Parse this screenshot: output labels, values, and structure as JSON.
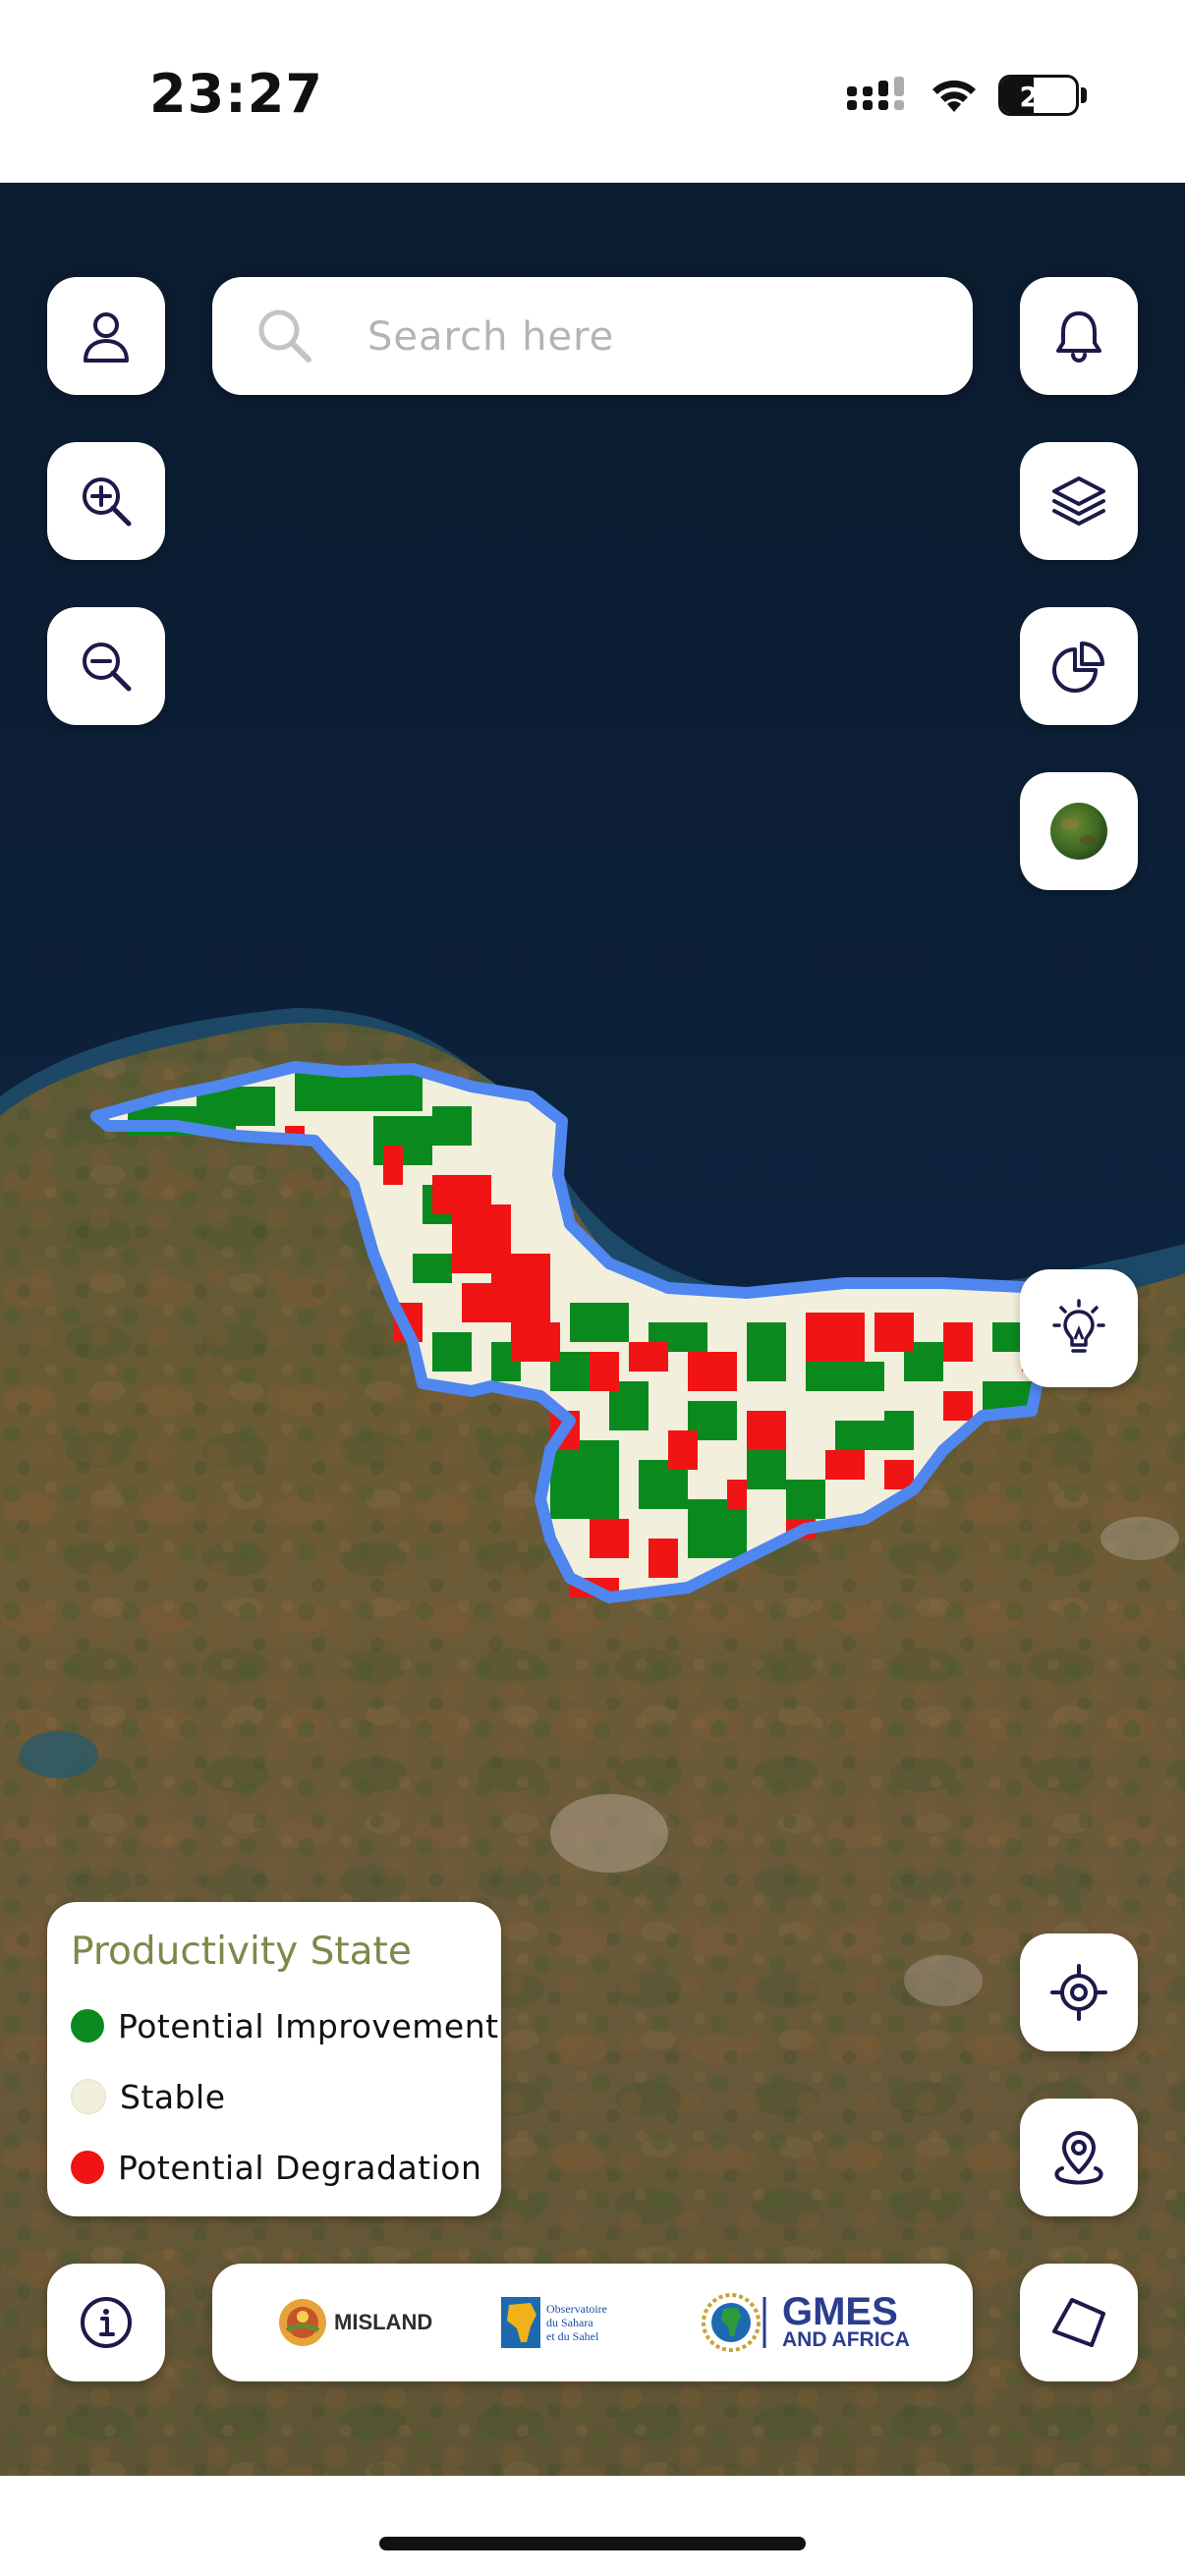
{
  "status_bar": {
    "time": "23:27",
    "battery_level": "22"
  },
  "search": {
    "placeholder": "Search here",
    "icon": "search-icon"
  },
  "left_controls": [
    {
      "name": "profile-button",
      "icon": "user-icon"
    },
    {
      "name": "zoom-in-button",
      "icon": "zoom-in-icon"
    },
    {
      "name": "zoom-out-button",
      "icon": "zoom-out-icon"
    }
  ],
  "right_controls": [
    {
      "name": "notifications-button",
      "icon": "bell-icon"
    },
    {
      "name": "layers-button",
      "icon": "layers-icon"
    },
    {
      "name": "statistics-button",
      "icon": "pie-chart-icon"
    },
    {
      "name": "basemap-button",
      "icon": "globe-thumbnail-icon"
    },
    {
      "name": "insights-button",
      "icon": "lightbulb-icon"
    },
    {
      "name": "locate-me-button",
      "icon": "crosshair-icon"
    },
    {
      "name": "location-pin-button",
      "icon": "map-pin-icon"
    },
    {
      "name": "draw-polygon-button",
      "icon": "polygon-icon"
    }
  ],
  "legend": {
    "title": "Productivity State",
    "items": [
      {
        "label": "Potential Improvement",
        "color": "#0a8a1e"
      },
      {
        "label": "Stable",
        "color": "#f2efdc"
      },
      {
        "label": "Potential Degradation",
        "color": "#f01414"
      }
    ]
  },
  "info_button": {
    "icon": "info-icon"
  },
  "logos": {
    "misland": "MISLAND",
    "oss_line1": "Observatoire",
    "oss_line2": "du Sahara",
    "oss_line3": "et du Sahel",
    "gmes_line1": "GMES",
    "gmes_line2": "AND AFRICA"
  },
  "colors": {
    "sea": "#0c1b2e",
    "boundary": "#4f86ef",
    "icon": "#1c1a4a"
  }
}
